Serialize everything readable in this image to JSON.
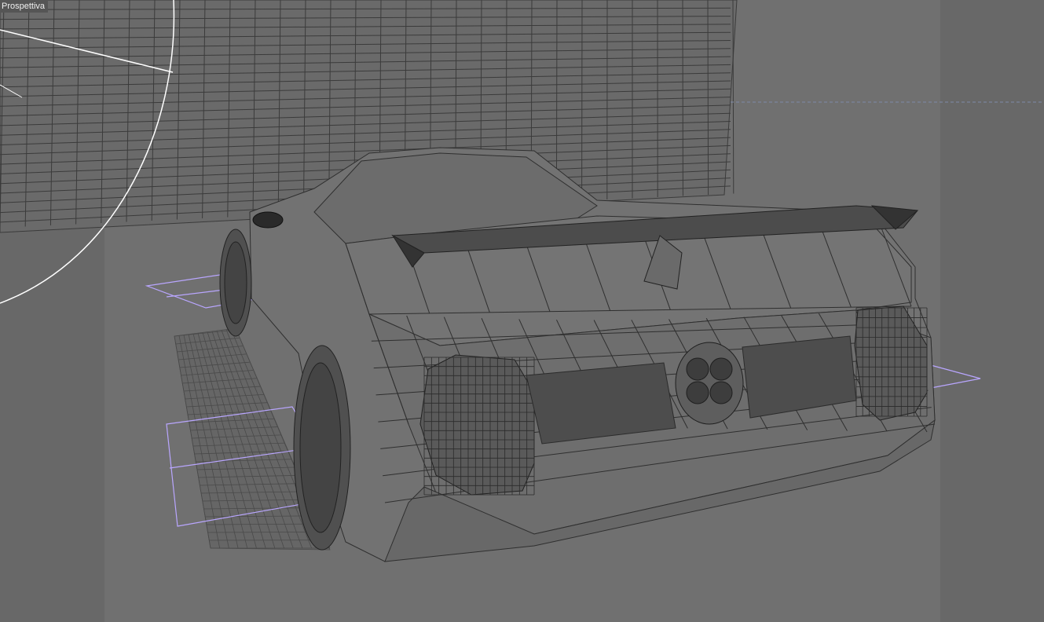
{
  "viewport": {
    "label": "Prospettiva",
    "background_color": "#707070",
    "safe_frame_color": "#686868",
    "wire_color": "#2f2f2f",
    "light_color": "#ffffff",
    "helper_color": "#b9a6ff",
    "guide_color": "#7e8aa8"
  },
  "scene": {
    "objects": [
      "backdrop-grid",
      "light-cone",
      "car-wireframe",
      "rear-wing",
      "left-wheels",
      "taillights",
      "exhausts",
      "helper-gizmos"
    ]
  }
}
